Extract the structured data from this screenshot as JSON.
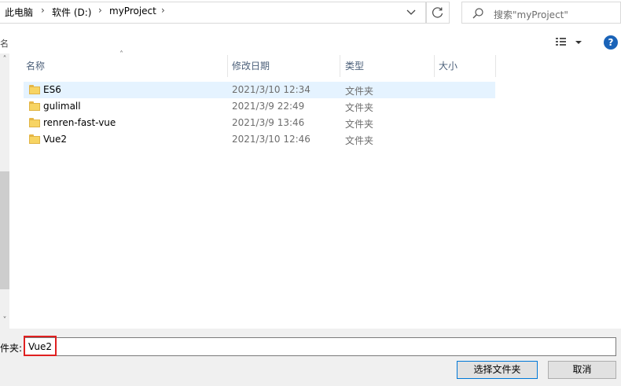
{
  "breadcrumb": {
    "items": [
      "此电脑",
      "软件 (D:)",
      "myProject"
    ]
  },
  "search": {
    "placeholder": "搜索\"myProject\""
  },
  "toolbar": {
    "left_label": "名"
  },
  "columns": {
    "name": "名称",
    "date": "修改日期",
    "type": "类型",
    "size": "大小"
  },
  "files": [
    {
      "name": "ES6",
      "date": "2021/3/10 12:34",
      "type": "文件夹",
      "selected": true
    },
    {
      "name": "gulimall",
      "date": "2021/3/9 22:49",
      "type": "文件夹",
      "selected": false
    },
    {
      "name": "renren-fast-vue",
      "date": "2021/3/9 13:46",
      "type": "文件夹",
      "selected": false
    },
    {
      "name": "Vue2",
      "date": "2021/3/10 12:46",
      "type": "文件夹",
      "selected": false
    }
  ],
  "footer": {
    "folder_label": "件夹:",
    "folder_value": "Vue2",
    "select_button": "选择文件夹",
    "cancel_button": "取消"
  },
  "colors": {
    "selection": "#e5f3ff",
    "highlight": "#e02020",
    "accent": "#0078d7"
  }
}
